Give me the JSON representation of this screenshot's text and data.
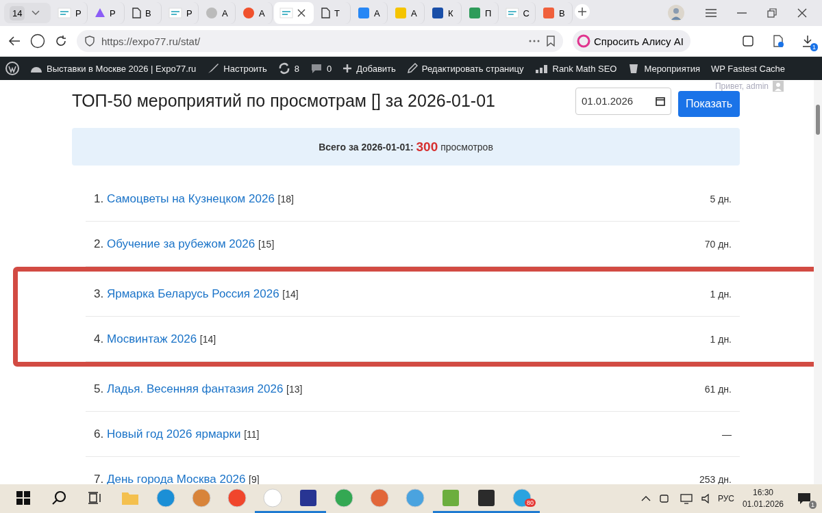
{
  "browser": {
    "tab_count": "14",
    "tabs": [
      {
        "letter": "Р",
        "selected": false
      },
      {
        "letter": "Р",
        "selected": false
      },
      {
        "letter": "В",
        "selected": false
      },
      {
        "letter": "Р",
        "selected": false
      },
      {
        "letter": "А",
        "selected": false
      },
      {
        "letter": "А",
        "selected": false
      },
      {
        "selected": true
      },
      {
        "letter": "Т",
        "selected": false
      },
      {
        "letter": "А",
        "selected": false
      },
      {
        "letter": "А",
        "selected": false
      },
      {
        "letter": "К",
        "selected": false
      },
      {
        "letter": "П",
        "selected": false
      },
      {
        "letter": "С",
        "selected": false
      },
      {
        "letter": "В",
        "selected": false
      }
    ],
    "url": "https://expo77.ru/stat/",
    "alice_button": "Спросить Алису AI",
    "downloads_badge": "1"
  },
  "admin_bar": [
    "Выставки в Москве 2026 | Expo77.ru",
    "Настроить",
    "8",
    "0",
    "Добавить",
    "Редактировать страницу",
    "Rank Math SEO",
    "Мероприятия",
    "WP Fastest Cache"
  ],
  "page": {
    "title": "ТОП-50 мероприятий по просмотрам [] за 2026-01-01",
    "date_value": "01.01.2026",
    "show_button": "Показать",
    "greeting": "Привет, admin",
    "summary": {
      "prefix": "Всего за 2026-01-01:",
      "total": "300",
      "suffix": "просмотров"
    },
    "events": [
      {
        "rank": "1.",
        "name": "Самоцветы на Кузнецком 2026",
        "views": "[18]",
        "days": "5 дн.",
        "highlighted": false
      },
      {
        "rank": "2.",
        "name": "Обучение за рубежом 2026",
        "views": "[15]",
        "days": "70 дн.",
        "highlighted": false
      },
      {
        "rank": "3.",
        "name": "Ярмарка Беларусь Россия 2026",
        "views": "[14]",
        "days": "1 дн.",
        "highlighted": true
      },
      {
        "rank": "4.",
        "name": "Мосвинтаж 2026",
        "views": "[14]",
        "days": "1 дн.",
        "highlighted": true
      },
      {
        "rank": "5.",
        "name": "Ладья. Весенняя фантазия 2026",
        "views": "[13]",
        "days": "61 дн.",
        "highlighted": false
      },
      {
        "rank": "6.",
        "name": "Новый год 2026 ярмарки",
        "views": "[11]",
        "days": "—",
        "highlighted": false
      },
      {
        "rank": "7.",
        "name": "День города Москва 2026",
        "views": "[9]",
        "days": "253 дн.",
        "highlighted": false
      }
    ]
  },
  "taskbar": {
    "apps": [
      {
        "active": false
      },
      {
        "active": false
      },
      {
        "active": false
      },
      {
        "active": false
      },
      {
        "active": true
      },
      {
        "active": true
      },
      {
        "active": false
      },
      {
        "active": false
      },
      {
        "active": false
      },
      {
        "active": true
      },
      {
        "active": true
      },
      {
        "active": true
      }
    ],
    "telegram_badge": "80",
    "language": "РУС",
    "time": "16:30",
    "date": "01.01.2026",
    "notifications_badge": "1"
  }
}
